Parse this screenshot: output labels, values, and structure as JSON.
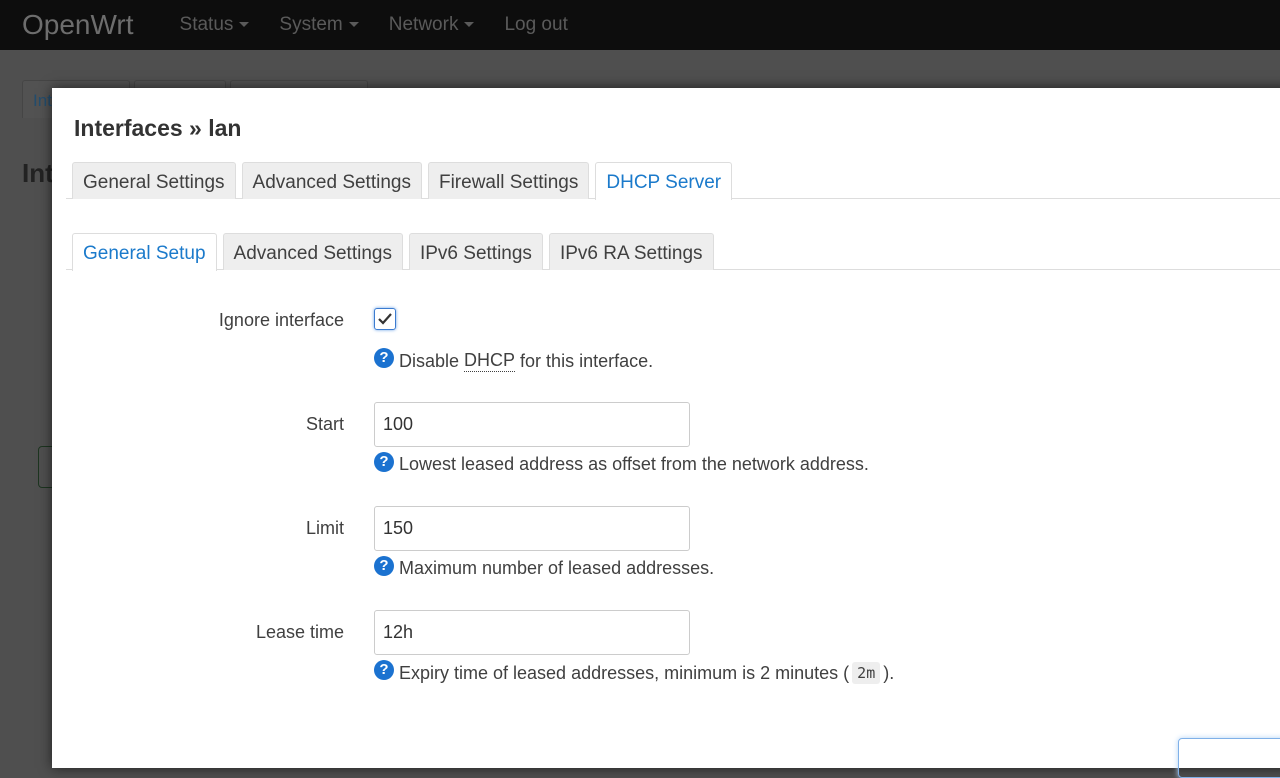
{
  "navbar": {
    "brand": "OpenWrt",
    "menus": [
      "Status",
      "System",
      "Network"
    ],
    "logout": "Log out"
  },
  "background": {
    "tab": "Int",
    "heading": "Int"
  },
  "modal": {
    "title": "Interfaces » lan",
    "tabs": [
      "General Settings",
      "Advanced Settings",
      "Firewall Settings",
      "DHCP Server"
    ],
    "active_tab": "DHCP Server",
    "subtabs": [
      "General Setup",
      "Advanced Settings",
      "IPv6 Settings",
      "IPv6 RA Settings"
    ],
    "active_subtab": "General Setup",
    "fields": {
      "ignore": {
        "label": "Ignore interface",
        "checked": true,
        "help_pre": "Disable ",
        "help_abbr": "DHCP",
        "help_post": " for this interface."
      },
      "start": {
        "label": "Start",
        "value": "100",
        "help": "Lowest leased address as offset from the network address."
      },
      "limit": {
        "label": "Limit",
        "value": "150",
        "help": "Maximum number of leased addresses."
      },
      "leasetime": {
        "label": "Lease time",
        "value": "12h",
        "help_pre": "Expiry time of leased addresses, minimum is 2 minutes (",
        "help_code": "2m",
        "help_post": ")."
      }
    }
  },
  "colors": {
    "accent": "#1b7acb",
    "help_icon": "#1b72d0",
    "navbar": "#0d0d0d"
  }
}
